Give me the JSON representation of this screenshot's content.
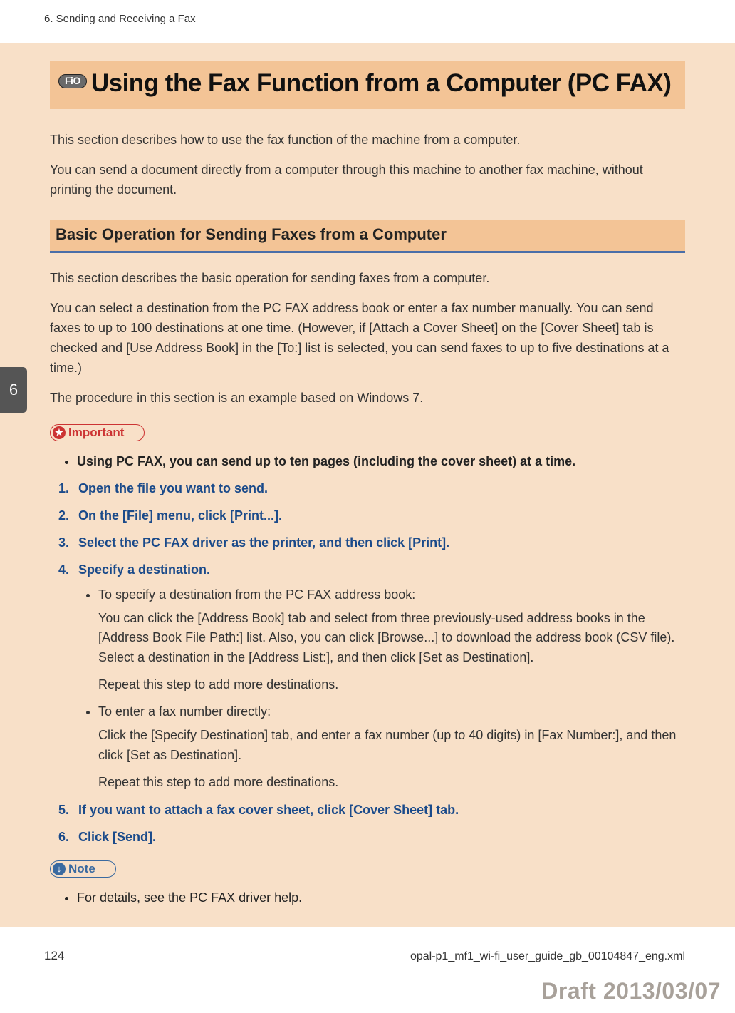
{
  "chapter_running_head": "6. Sending and Receiving a Fax",
  "chapter_tab": "6",
  "page_number": "124",
  "source_file": "opal-p1_mf1_wi-fi_user_guide_gb_00104847_eng.xml",
  "draft_stamp": "Draft 2013/03/07",
  "title": {
    "badge": "FiO",
    "text": "Using the Fax Function from a Computer (PC FAX)"
  },
  "intro": {
    "p1": "This section describes how to use the fax function of the machine from a computer.",
    "p2": "You can send a document directly from a computer through this machine to another fax machine, without printing the document."
  },
  "subheading": "Basic Operation for Sending Faxes from a Computer",
  "basic": {
    "p1": "This section describes the basic operation for sending faxes from a computer.",
    "p2": "You can select a destination from the PC FAX address book or enter a fax number manually. You can send faxes to up to 100 destinations at one time. (However, if [Attach a Cover Sheet] on the [Cover Sheet] tab is checked and [Use Address Book] in the [To:] list is selected, you can send faxes to up to five destinations at a time.)",
    "p3": "The procedure in this section is an example based on Windows 7."
  },
  "important": {
    "label": "Important",
    "items": [
      "Using PC FAX, you can send up to ten pages (including the cover sheet) at a time."
    ]
  },
  "steps": {
    "s1": "Open the file you want to send.",
    "s2": "On the [File] menu, click [Print...].",
    "s3": "Select the PC FAX driver as the printer, and then click [Print].",
    "s4": {
      "title": "Specify a destination.",
      "sub": [
        {
          "lead": "To specify a destination from the PC FAX address book:",
          "para1": "You can click the [Address Book] tab and select from three previously-used address books in the [Address Book File Path:] list. Also, you can click [Browse...] to download the address book (CSV file). Select a destination in the [Address List:], and then click [Set as Destination].",
          "para2": "Repeat this step to add more destinations."
        },
        {
          "lead": "To enter a fax number directly:",
          "para1": "Click the [Specify Destination] tab, and enter a fax number (up to 40 digits) in [Fax Number:], and then click [Set as Destination].",
          "para2": "Repeat this step to add more destinations."
        }
      ]
    },
    "s5": "If you want to attach a fax cover sheet, click [Cover Sheet] tab.",
    "s6": "Click [Send]."
  },
  "note": {
    "label": "Note",
    "items": [
      "For details, see the PC FAX driver help."
    ]
  }
}
